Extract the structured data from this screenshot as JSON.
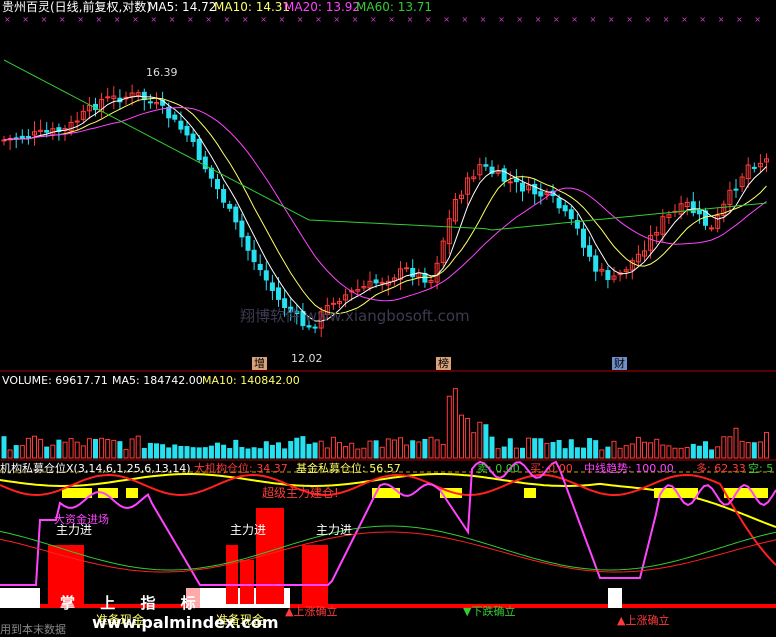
{
  "colors": {
    "up": "#ff3b3b",
    "down": "#27e0f0",
    "ma5": "#ffffff",
    "ma10": "#ffff66",
    "ma20": "#ff44ff",
    "ma60": "#33cc33",
    "grid": "#b00000"
  },
  "price_header": {
    "title": "贵州百灵(日线,前复权,对数)",
    "ma5": "MA5: 14.72",
    "ma10": "MA10: 14.31",
    "ma20": "MA20: 13.92",
    "ma60": "MA60: 13.71"
  },
  "price_labels": {
    "high": "16.39",
    "low": "12.02"
  },
  "watermark": "翔博软件  www.xiangbosoft.com",
  "event_badges": [
    {
      "text": "增"
    },
    {
      "text": "榜"
    },
    {
      "text": "财"
    }
  ],
  "volume_header": {
    "title": "VOLUME: 69617.71",
    "ma5": "MA5: 184742.00",
    "ma10": "MA10: 140842.00"
  },
  "indicator_header": {
    "title": "机构私募仓位X(3,14,6,1,25,6,13,14)",
    "inst": "大机构仓位: 34.37",
    "fund": "基金私募仓位: 56.57",
    "sell": "卖: 0.00",
    "buy": "买: 0.00",
    "trend": "中线趋势: 100.00",
    "long": "多: 62.33",
    "short": "空: 5"
  },
  "indicator_labels": {
    "super_main": "超级主力建仓!",
    "big_fund": "大资金进场",
    "main_in": [
      "主力进",
      "主力进",
      "主力进"
    ],
    "prepare_cash": "准备现金",
    "prepare_cash_2": "准备现金",
    "rise1": "▲上涨确立",
    "fall": "▼下跌确立",
    "rise2": "▲上涨确立",
    "zhangshang": "掌 上 指 标",
    "footer_left": "用到本末数据",
    "footer_url": "www.palmindex.com"
  }
}
